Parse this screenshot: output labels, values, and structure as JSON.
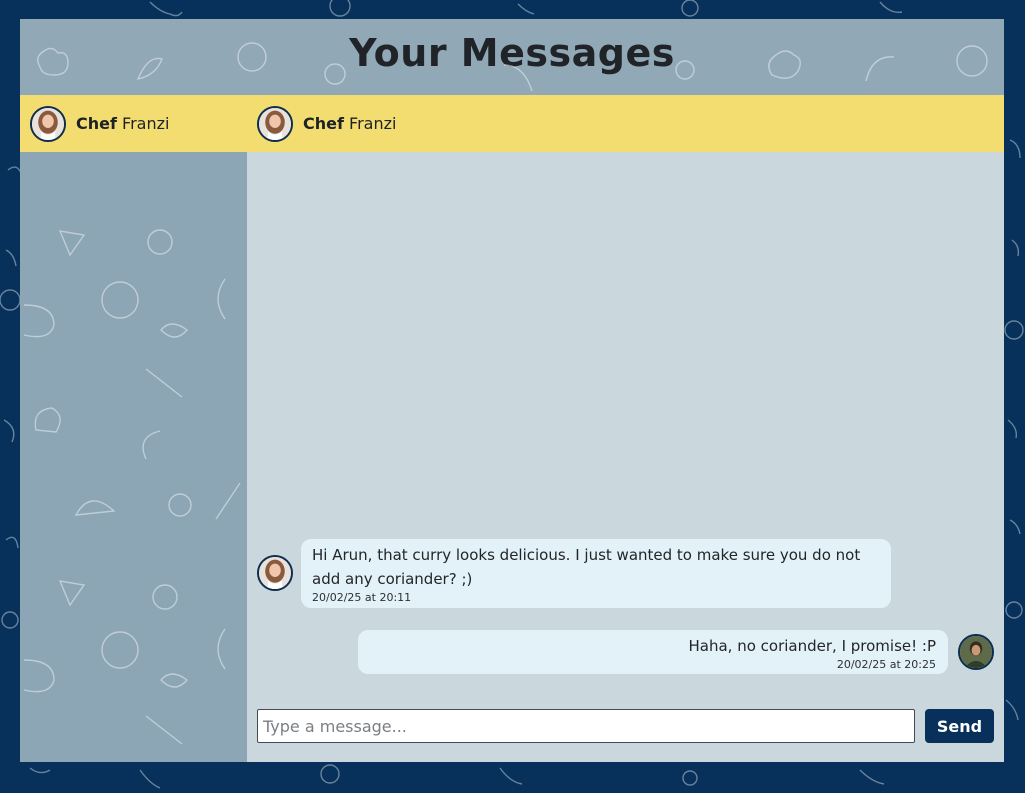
{
  "page": {
    "title": "Your Messages"
  },
  "sidebar": {
    "contacts": [
      {
        "title": "Chef",
        "name": "Franzi",
        "avatar": "chef-franzi-avatar",
        "active": true
      }
    ]
  },
  "chat": {
    "header": {
      "title": "Chef",
      "name": "Franzi"
    },
    "messages": [
      {
        "direction": "incoming",
        "text": "Hi Arun, that curry looks delicious. I just wanted to make sure you do not add any coriander? ;)",
        "timestamp": "20/02/25 at 20:11"
      },
      {
        "direction": "outgoing",
        "text": "Haha, no coriander, I promise! :P",
        "timestamp": "20/02/25 at 20:25"
      }
    ],
    "composer": {
      "placeholder": "Type a message...",
      "value": "",
      "send_label": "Send"
    }
  },
  "colors": {
    "background": "#07305a",
    "panel": "#91a8b7",
    "active_contact": "#f4dd70",
    "chat_area": "#cad7dd",
    "bubble": "#e3f1f8",
    "send_button": "#07305a"
  },
  "icons": [
    "food-doodle-icon",
    "avatar-photo"
  ]
}
